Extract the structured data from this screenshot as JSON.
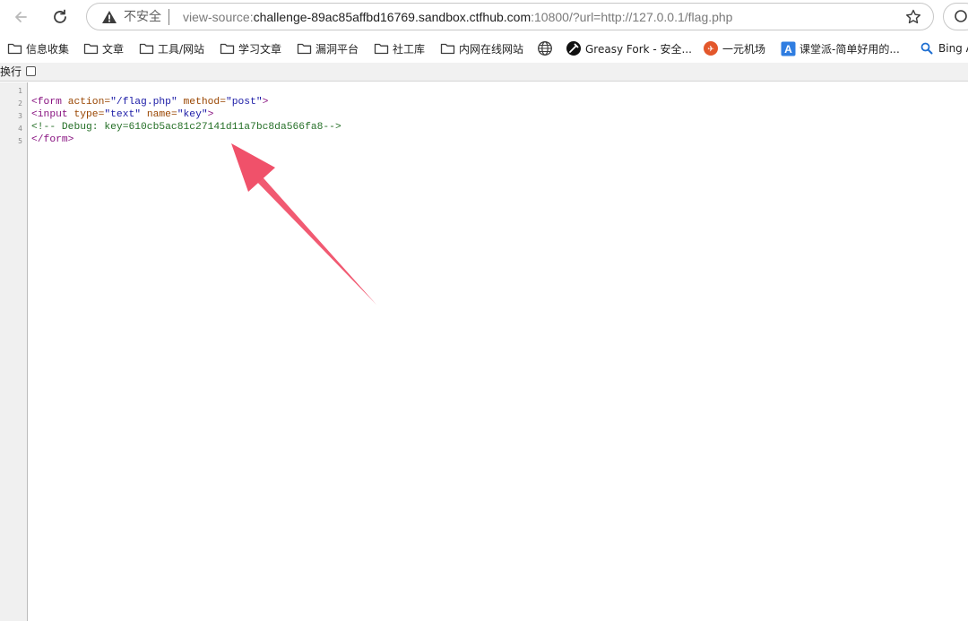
{
  "toolbar": {
    "security_label": "不安全",
    "url_scheme": "view-source:",
    "url_host": "challenge-89ac85affbd16769.sandbox.ctfhub.com",
    "url_rest": ":10800/?url=http://127.0.0.1/flag.php"
  },
  "bookmarks": {
    "items": [
      {
        "label": "信息收集",
        "icon": "folder-icon"
      },
      {
        "label": "文章",
        "icon": "folder-icon"
      },
      {
        "label": "工具/网站",
        "icon": "folder-icon"
      },
      {
        "label": "学习文章",
        "icon": "folder-icon"
      },
      {
        "label": "漏洞平台",
        "icon": "folder-icon"
      },
      {
        "label": "社工库",
        "icon": "folder-icon"
      },
      {
        "label": "内网在线网站",
        "icon": "folder-icon"
      },
      {
        "label": "",
        "icon": "globe-icon"
      },
      {
        "label": "Greasy Fork - 安全...",
        "icon": "greasyfork-icon"
      },
      {
        "label": "一元机场",
        "icon": "airport-icon"
      },
      {
        "label": "课堂派-简单好用的...",
        "icon": "ketangpai-icon"
      },
      {
        "label": "Bing A",
        "icon": "bing-search-icon"
      }
    ]
  },
  "wrapbar": {
    "label": "换行"
  },
  "source": {
    "line_numbers": [
      "1",
      "2",
      "3",
      "4",
      "5"
    ],
    "line2": {
      "open": "<form ",
      "attr1": "action=",
      "val1": "\"/flag.php\"",
      "attr2": " method=",
      "val2": "\"post\"",
      "close": ">"
    },
    "line3": {
      "open": "<input ",
      "attr1": "type=",
      "val1": "\"text\"",
      "attr2": " name=",
      "val2": "\"key\"",
      "close": ">"
    },
    "line4": {
      "comment": "<!-- Debug: key=610cb5ac81c27141d11a7bc8da566fa8-->"
    },
    "line5": {
      "tag": "</form>"
    }
  },
  "colors": {
    "tag": "#881280",
    "attr": "#994500",
    "value": "#1a1aa6",
    "comment": "#236e25",
    "annotation_arrow": "#f0516a"
  }
}
